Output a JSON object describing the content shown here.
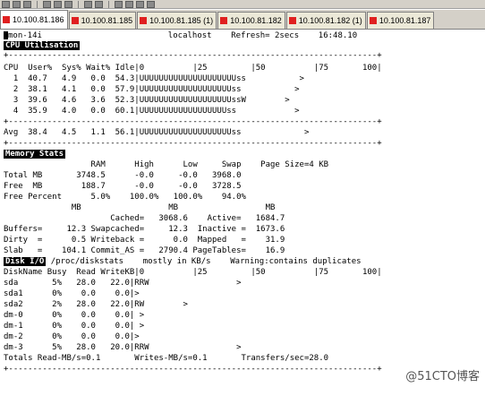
{
  "toolbar": {
    "icons": [
      "new-icon",
      "open-icon",
      "save-icon",
      "cut-icon",
      "copy-icon",
      "paste-icon",
      "find-icon",
      "print-icon",
      "settings-icon",
      "key-icon",
      "disconnect-icon",
      "help-icon"
    ]
  },
  "tabs": [
    {
      "label": "10.100.81.186"
    },
    {
      "label": "10.100.81.185"
    },
    {
      "label": "10.100.81.185 (1)"
    },
    {
      "label": "10.100.81.182"
    },
    {
      "label": "10.100.81.182 (1)"
    },
    {
      "label": "10.100.81.187"
    }
  ],
  "terminal": {
    "status_bar": "mon-14i                          localhost    Refresh= 2secs    16:48.10",
    "cpu": {
      "title": "CPU Utilisation",
      "header": "CPU  User%  Sys% Wait% Idle|0          |25         |50          |75       100|",
      "rows": [
        "  1  40.7   4.9   0.0  54.3|UUUUUUUUUUUUUUUUUUUUss           >",
        "  2  38.1   4.1   0.0  57.9|UUUUUUUUUUUUUUUUUUUss           >",
        "  3  39.6   4.6   3.6  52.3|UUUUUUUUUUUUUUUUUUUssW        >",
        "  4  35.9   4.0   0.0  60.1|UUUUUUUUUUUUUUUUUUss            >"
      ],
      "avg": "Avg  38.4   4.5   1.1  56.1|UUUUUUUUUUUUUUUUUUUss             >"
    },
    "memory": {
      "title": "Memory Stats",
      "lines": [
        "                  RAM      High      Low     Swap    Page Size=4 KB",
        "Total MB       3748.5      -0.0     -0.0   3968.0",
        "Free  MB        188.7      -0.0     -0.0   3728.5",
        "Free Percent      5.0%    100.0%   100.0%    94.0%",
        "              MB                  MB                  MB",
        "                      Cached=   3068.6    Active=   1684.7",
        "Buffers=     12.3 Swapcached=     12.3  Inactive =  1673.6",
        "Dirty  =      0.5 Writeback =      0.0  Mapped   =    31.9",
        "Slab   =    104.1 Commit_AS =   2790.4 PageTables=    16.9"
      ]
    },
    "disk": {
      "title": "Disk I/O",
      "subtitle": "/proc/diskstats    mostly in KB/s    Warning:contains duplicates",
      "header": "DiskName Busy  Read WriteKB|0          |25         |50          |75       100|",
      "rows": [
        "sda       5%   28.0   22.0|RRW                  >",
        "sda1      0%    0.0    0.0|>",
        "sda2      2%   28.0   22.0|RW        >",
        "dm-0      0%    0.0    0.0| >",
        "dm-1      0%    0.0    0.0| >",
        "dm-2      0%    0.0    0.0|>",
        "dm-3      5%   28.0   20.0|RRW                  >"
      ],
      "totals": "Totals Read-MB/s=0.1       Writes-MB/s=0.1       Transfers/sec=28.0"
    }
  },
  "watermark": "@51CTO博客"
}
